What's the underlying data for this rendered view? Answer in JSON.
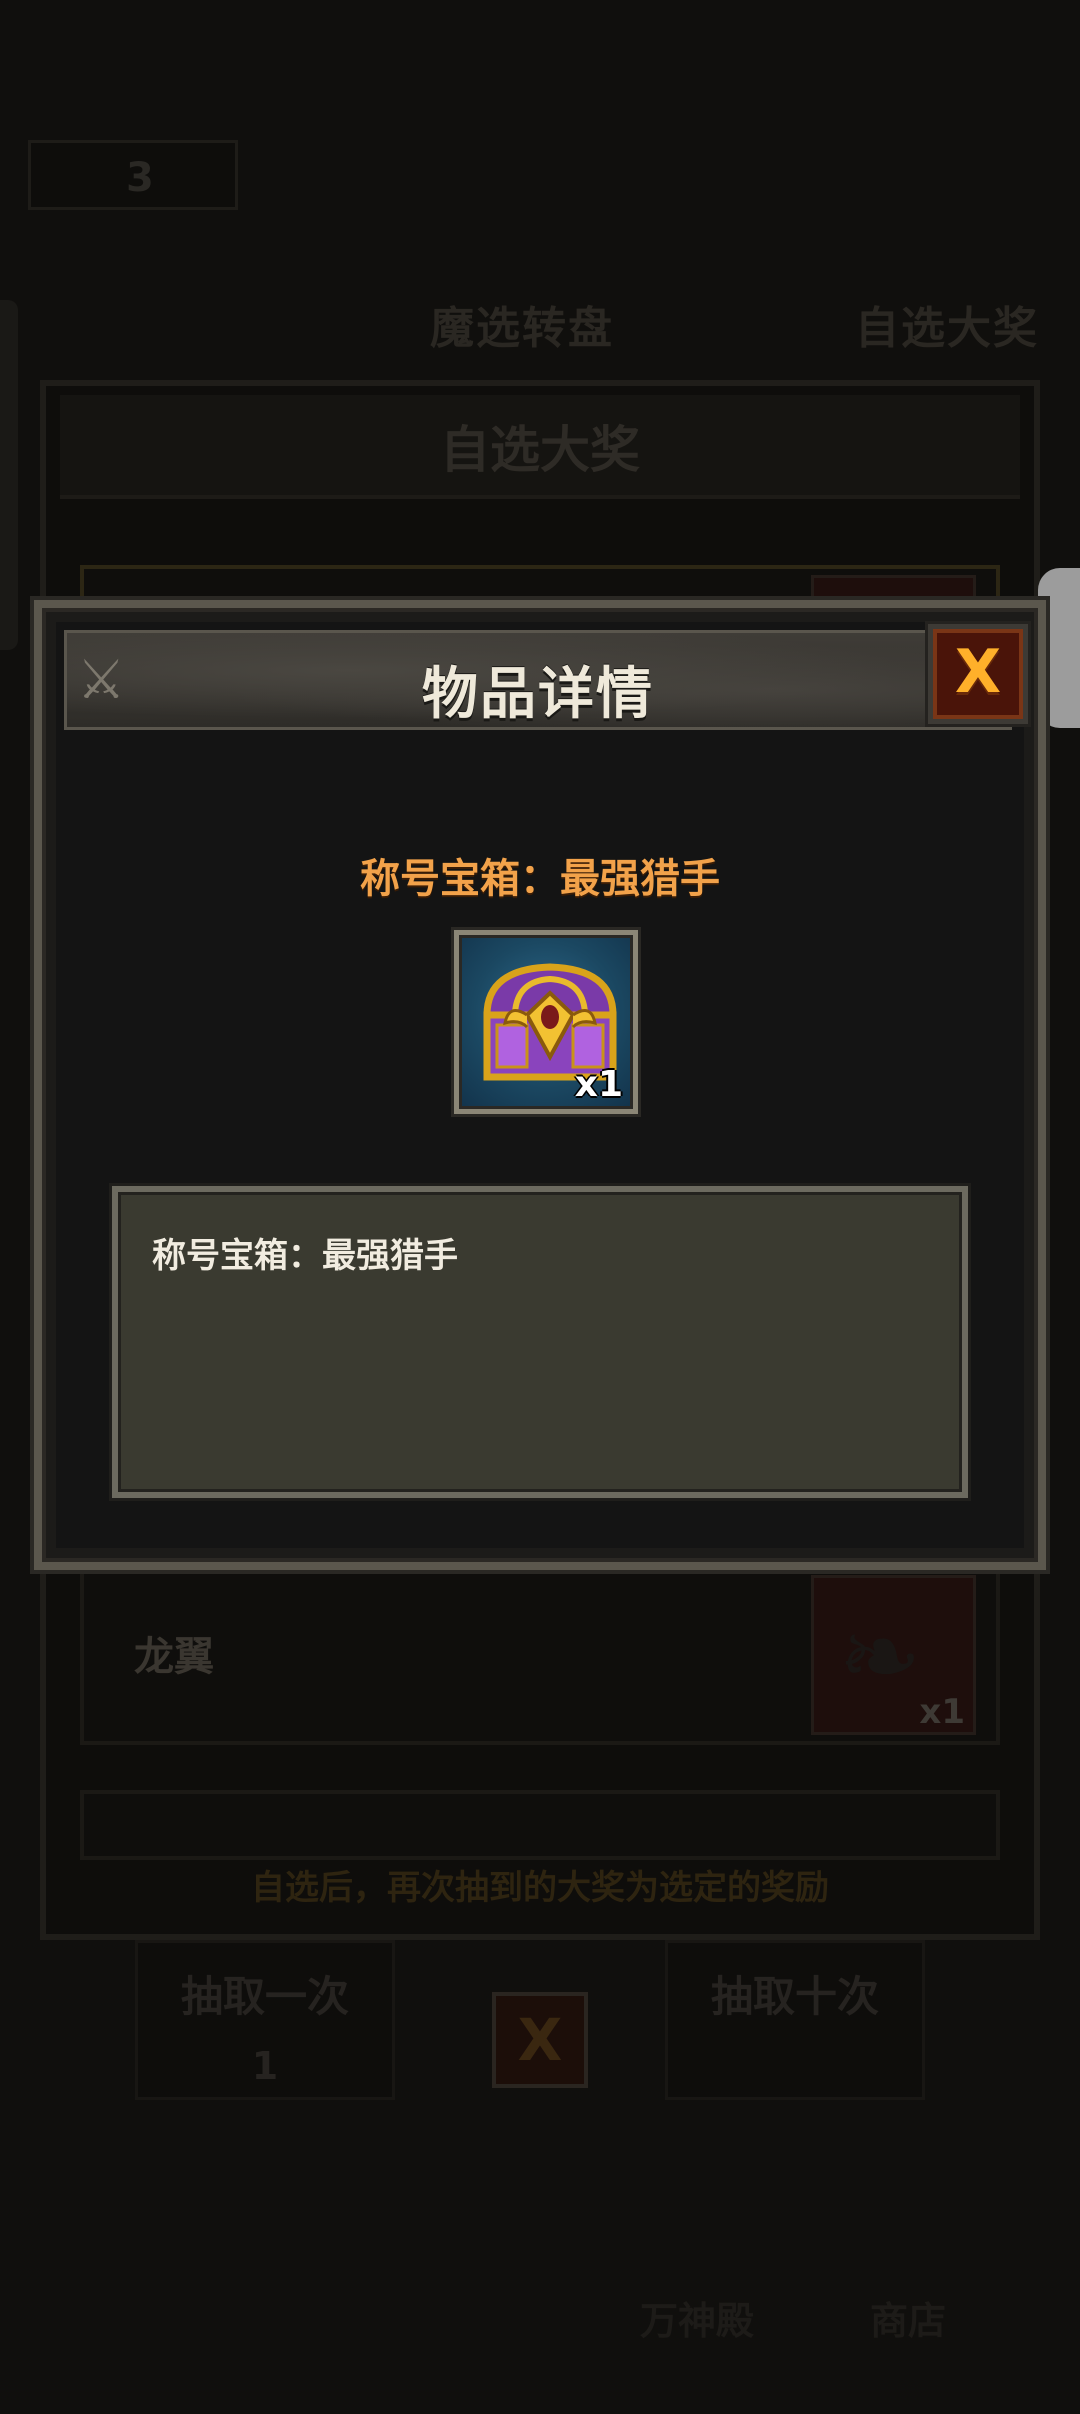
{
  "background": {
    "counter": "3",
    "tabs": [
      "魔选转盘",
      "自选大奖"
    ],
    "panel_title": "自选大奖",
    "rows": [
      {
        "name": "",
        "qty": ""
      },
      {
        "name": "龙翼",
        "qty": "x1"
      }
    ],
    "footnote": "自选后，再次抽到的大奖为选定的奖励",
    "buttons": [
      {
        "label": "抽取一次",
        "cost": "1"
      },
      {
        "label": "抽取十次",
        "cost": ""
      }
    ],
    "close_label": "X",
    "nav": [
      "万神殿",
      "商店"
    ]
  },
  "modal": {
    "title": "物品详情",
    "close_label": "X",
    "item_name": "称号宝箱：最强猎手",
    "item_qty": "x1",
    "description": "称号宝箱：最强猎手",
    "icon": "treasure-chest-icon"
  },
  "colors": {
    "title_text": "#efe9da",
    "item_name": "#f2a24a",
    "close_x": "#ffb02a",
    "close_bg": "#4a1409",
    "desc_bg": "#3a3a30"
  }
}
